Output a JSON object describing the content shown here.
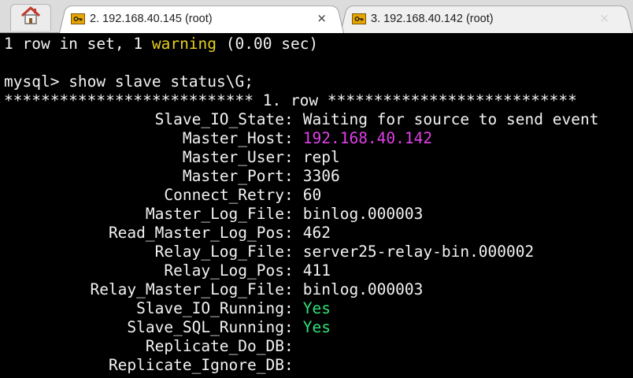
{
  "colors": {
    "warning": "#e8d020",
    "host_ip": "#e040e8",
    "running_yes": "#33e07a",
    "terminal_bg": "#000000",
    "terminal_fg": "#f2f2f2",
    "tab_icon": "#e8a500"
  },
  "tabs": [
    {
      "label": "2. 192.168.40.145 (root)",
      "icon": "key-icon",
      "close": "×",
      "active": true
    },
    {
      "label": "3. 192.168.40.142 (root)",
      "icon": "key-icon",
      "close": "×",
      "active": false
    }
  ],
  "home_icon": "home-icon",
  "terminal": {
    "summary": {
      "prefix": "1 row in set, 1 ",
      "warning_word": "warning",
      "suffix": " (0.00 sec)"
    },
    "prompt": "mysql> ",
    "command": "show slave status\\G;",
    "row_header": "*************************** 1. row ***************************",
    "fields": [
      {
        "key": "Slave_IO_State",
        "value": "Waiting for source to send event"
      },
      {
        "key": "Master_Host",
        "value": "192.168.40.142"
      },
      {
        "key": "Master_User",
        "value": "repl"
      },
      {
        "key": "Master_Port",
        "value": "3306"
      },
      {
        "key": "Connect_Retry",
        "value": "60"
      },
      {
        "key": "Master_Log_File",
        "value": "binlog.000003"
      },
      {
        "key": "Read_Master_Log_Pos",
        "value": "462"
      },
      {
        "key": "Relay_Log_File",
        "value": "server25-relay-bin.000002"
      },
      {
        "key": "Relay_Log_Pos",
        "value": "411"
      },
      {
        "key": "Relay_Master_Log_File",
        "value": "binlog.000003"
      },
      {
        "key": "Slave_IO_Running",
        "value": "Yes"
      },
      {
        "key": "Slave_SQL_Running",
        "value": "Yes"
      },
      {
        "key": "Replicate_Do_DB",
        "value": ""
      },
      {
        "key": "Replicate_Ignore_DB",
        "value": ""
      }
    ]
  }
}
